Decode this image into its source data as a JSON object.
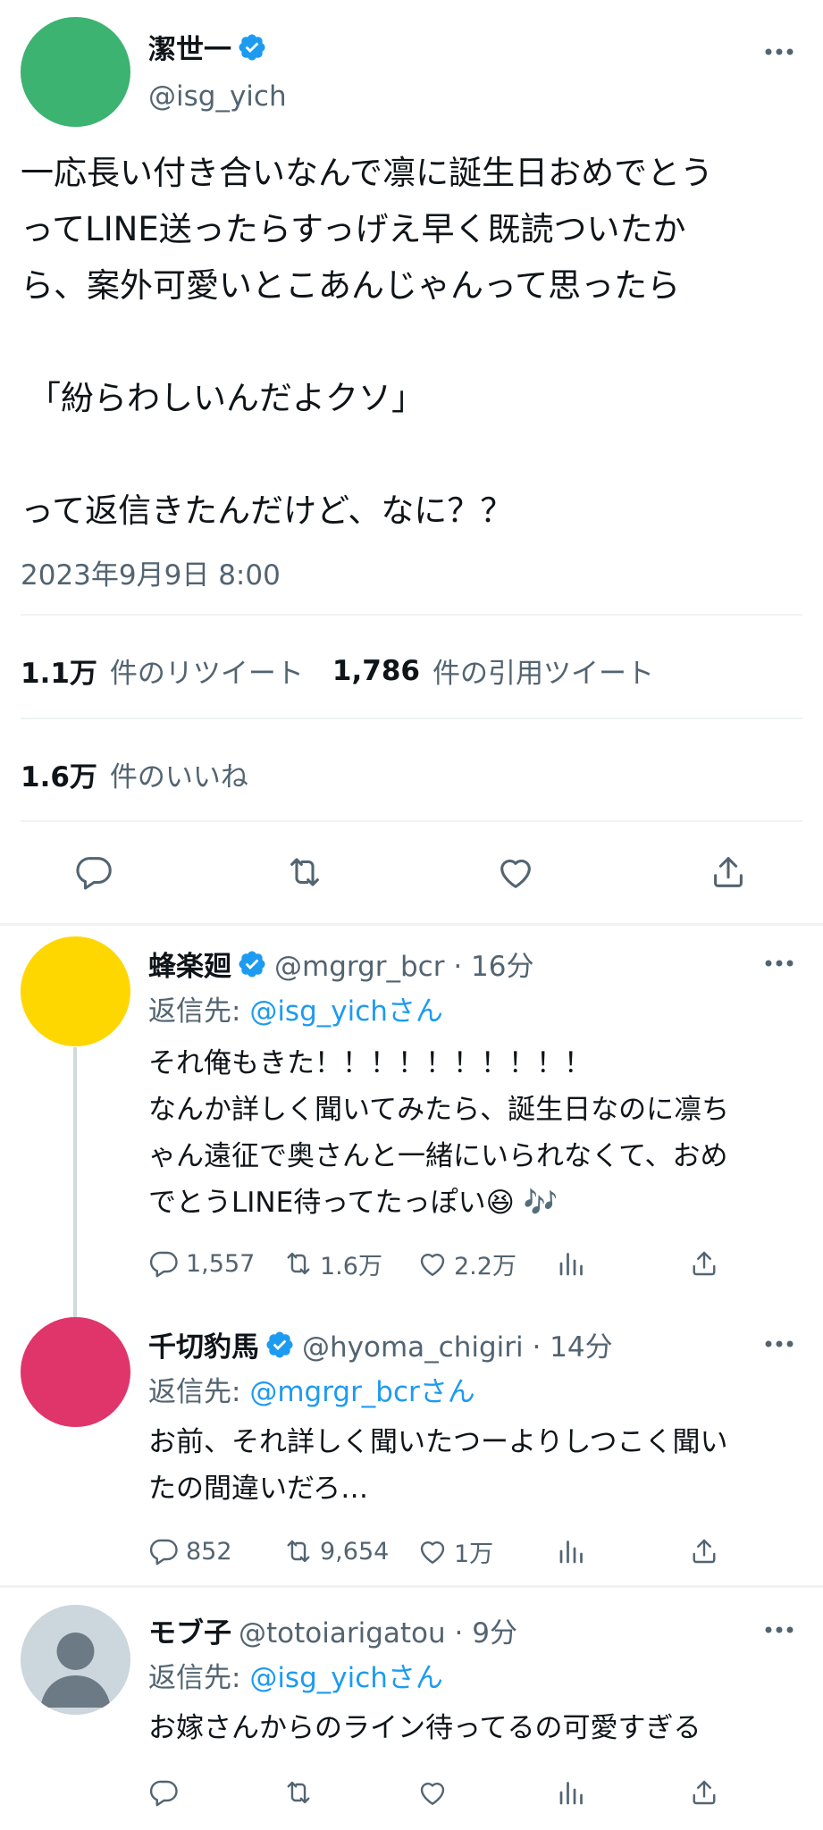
{
  "main_tweet": {
    "author": {
      "name": "潔世一",
      "handle": "@isg_yich",
      "avatar_color": "#3cb371",
      "verified": true
    },
    "paragraphs": [
      "一応長い付き合いなんで凛に誕生日おめでとう\nってLINE送ったらすっげえ早く既読ついたか\nら、案外可愛いとこあんじゃんって思ったら",
      "「紛らわしいんだよクソ」",
      "って返信きたんだけど、なに？？"
    ],
    "timestamp": "2023年9月9日 8:00",
    "stats": {
      "retweets": {
        "count": "1.1万",
        "label": "件のリツイート"
      },
      "quotes": {
        "count": "1,786",
        "label": "件の引用ツイート"
      },
      "likes": {
        "count": "1.6万",
        "label": "件のいいね"
      }
    },
    "actions": [
      "reply-icon",
      "retweet-icon",
      "like-icon",
      "share-icon"
    ]
  },
  "replies": [
    {
      "name": "蜂楽廻",
      "handle": "@mgrgr_bcr · 16分",
      "verified": true,
      "avatar_color": "#ffd700",
      "reply_to_prefix": "返信先: ",
      "reply_to": "@isg_yichさん",
      "text": "それ俺もきた！！！！！！！！！！\nなんか詳しく聞いてみたら、誕生日なのに凛ち\nゃん遠征で奥さんと一緒にいられなくて、おめ\nでとうLINE待ってたっぽい😆 🎶",
      "replies": "1,557",
      "retweets": "1.6万",
      "likes": "2.2万"
    },
    {
      "name": "千切豹馬",
      "handle": "@hyoma_chigiri · 14分",
      "verified": true,
      "avatar_color": "#e0356a",
      "reply_to_prefix": "返信先: ",
      "reply_to": "@mgrgr_bcrさん",
      "text": "お前、それ詳しく聞いたつーよりしつこく聞い\nたの間違いだろ…",
      "replies": "852",
      "retweets": "9,654",
      "likes": "1万"
    },
    {
      "name": "モブ子",
      "handle": "@totoiarigatou · 9分",
      "verified": false,
      "avatar_color": "#ccd6dd",
      "reply_to_prefix": "返信先: ",
      "reply_to": "@isg_yichさん",
      "text": "お嫁さんからのライン待ってるの可愛すぎる",
      "replies": "",
      "retweets": "",
      "likes": ""
    }
  ],
  "colors": {
    "accent": "#1d9bf0",
    "text": "#0f1419",
    "secondary": "#536471",
    "divider": "#eff3f4"
  }
}
